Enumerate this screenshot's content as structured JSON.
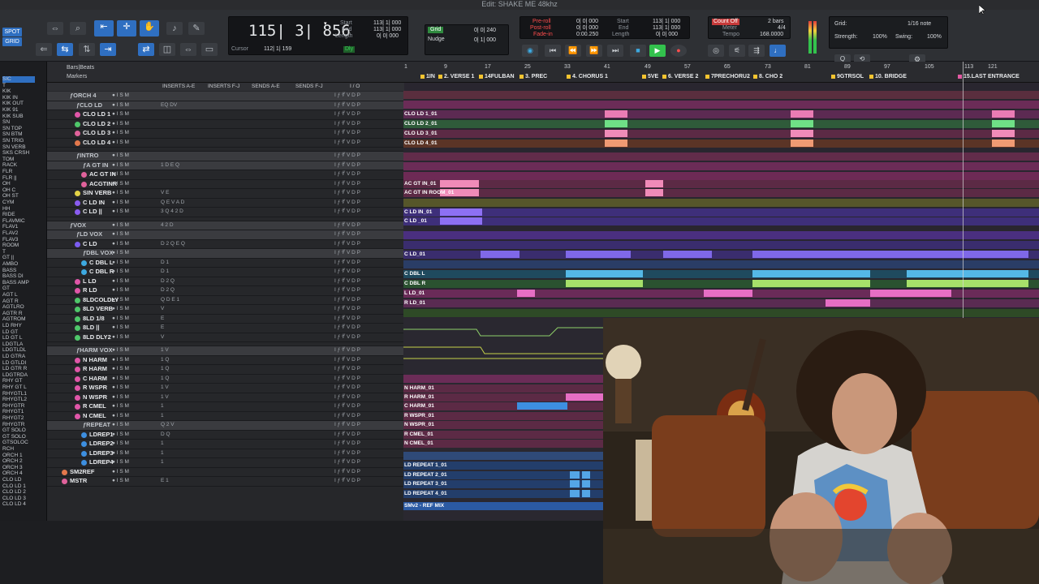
{
  "window": {
    "title": "Edit: SHAKE ME 48khz"
  },
  "toolbar": {
    "spot_label": "SPOT",
    "grid_label": "GRID",
    "counter_main": "115| 3| 856",
    "cursor_label": "Cursor",
    "cursor_value": "112| 1| 159",
    "sel_start_label": "Start",
    "sel_end_label": "End",
    "sel_length_label": "Length",
    "sel_start": "113| 1| 000",
    "sel_end": "113| 1| 000",
    "sel_length": "0| 0| 000",
    "grid_btn": "Grid",
    "nudge_btn": "Nudge",
    "grid_val": "0| 0| 240",
    "nudge_val": "0| 1| 000",
    "preroll_label": "Pre-roll",
    "postroll_label": "Post-roll",
    "fadein_label": "Fade-in",
    "preroll": "0| 0| 000",
    "postroll": "0| 0| 000",
    "fadein": "0:00.250",
    "start2_label": "Start",
    "end2_label": "End",
    "length2_label": "Length",
    "start2": "113| 1| 000",
    "end2": "113| 1| 000",
    "length2": "0| 0| 000",
    "count_off": "Count Off",
    "meter_label": "Meter",
    "tempo_label": "Tempo",
    "bars": "2 bars",
    "meter": "4/4",
    "tempo": "168.0000",
    "dly_label": "Dly",
    "grid_setting": "Grid:",
    "grid_note": "1/16 note",
    "strength_label": "Strength:",
    "strength": "100%",
    "swing_label": "Swing:",
    "swing": "100%"
  },
  "left_tracks": [
    "SIC",
    "T",
    "KIK",
    "KIK IN",
    "KIK OUT",
    "KIK 91",
    "KIK SUB",
    "SN",
    "SN TOP",
    "SN BTM",
    "SN TRIG",
    "SN VERB",
    "SKS CRSH",
    "TOM",
    "RACK",
    "FLR",
    "FLR ||",
    "OH",
    "OH C",
    "OH ST",
    "CYM",
    "HH",
    "RIDE",
    "FLAVMIC",
    "FLAV1",
    "FLAV2",
    "FLAV3",
    "ROOM",
    "T",
    "GT ||",
    "AMBO",
    "BASS",
    "BASS DI",
    "BASS AMP",
    "GT",
    "AGT L",
    "AGT R",
    "AGTLRO",
    "AGTR R",
    "AGTROM",
    "LD RHY",
    "LD GT",
    "LD GT L",
    "LDGTLA",
    "LDGTLDL",
    "LD GTRA",
    "LD GTLDI",
    "LD GTR R",
    "LDGTRDA",
    "RHY GT",
    "RHY GT L",
    "RHYGTL1",
    "RHYGTL2",
    "RHYGTR",
    "RHYGT1",
    "RHYGT2",
    "RHYGTR",
    "GT SOLO",
    "GT SOLO",
    "GTSOLOC",
    "RCH",
    "ORCH 1",
    "ORCH 2",
    "ORCH 3",
    "ORCH 4",
    "CLO LD",
    "CLO LD 1",
    "CLO LD 2",
    "CLO LD 3",
    "CLO LD 4"
  ],
  "header": {
    "bars_beats": "Bars|Beats",
    "markers": "Markers",
    "inserts_ae": "INSERTS A-E",
    "inserts_fj": "INSERTS F-J",
    "sends_ae": "SENDS A-E",
    "sends_fj": "SENDS F-J",
    "io": "I / O"
  },
  "ruler": [
    "1",
    "9",
    "17",
    "25",
    "33",
    "41",
    "49",
    "57",
    "65",
    "73",
    "81",
    "89",
    "97",
    "105",
    "113",
    "121"
  ],
  "markers": [
    "1IN",
    "2. VERSE 1",
    "14FULBAN",
    "3. PREC",
    "4. CHORUS 1",
    "5VE",
    "6. VERSE 2",
    "7PRECHORU2",
    "8. CHO 2",
    "9GTRSOL",
    "10. BRIDGE",
    "15.LAST ENTRANCE"
  ],
  "tracks": [
    {
      "name": "ORCH 4",
      "indent": 0,
      "folder": true
    },
    {
      "name": "CLO LD",
      "indent": 1,
      "folder": true,
      "ins": "EQ DV"
    },
    {
      "name": "CLO LD 1",
      "indent": 2,
      "color": "#e056a8"
    },
    {
      "name": "CLO LD 2",
      "indent": 2,
      "color": "#4fc76a"
    },
    {
      "name": "CLO LD 3",
      "indent": 2,
      "color": "#e0629b"
    },
    {
      "name": "CLO LD 4",
      "indent": 2,
      "color": "#e3784c"
    },
    {
      "name": "",
      "indent": 0,
      "spacer": true
    },
    {
      "name": "INTRO",
      "indent": 1,
      "folder": true
    },
    {
      "name": "A GT IN",
      "indent": 2,
      "folder": true,
      "ins": "1 D E Q"
    },
    {
      "name": "AC GT IN",
      "indent": 3,
      "color": "#e0629b"
    },
    {
      "name": "ACGTINR",
      "indent": 3,
      "color": "#e0629b"
    },
    {
      "name": "SIN VERB",
      "indent": 2,
      "color": "#e3d346",
      "ins": "V E"
    },
    {
      "name": "C LD IN",
      "indent": 2,
      "color": "#8a5cf0",
      "ins": "Q E V A   D"
    },
    {
      "name": "C LD ||",
      "indent": 2,
      "color": "#8a5cf0",
      "ins": "3 Q 4 2   D"
    },
    {
      "name": "",
      "indent": 0,
      "spacer": true
    },
    {
      "name": "VOX",
      "indent": 0,
      "folder": true,
      "ins": "4 2   D"
    },
    {
      "name": "LD VOX",
      "indent": 1,
      "folder": true
    },
    {
      "name": "C LD",
      "indent": 2,
      "color": "#7b5cf0",
      "ins": "D 2 Q E Q"
    },
    {
      "name": "DBL VOX",
      "indent": 2,
      "folder": true
    },
    {
      "name": "C DBL L",
      "indent": 3,
      "color": "#3da9e0",
      "ins": "D 1"
    },
    {
      "name": "C DBL R",
      "indent": 3,
      "color": "#3da9e0",
      "ins": "D 1"
    },
    {
      "name": "L LD",
      "indent": 2,
      "color": "#e056a8",
      "ins": "D 2 Q"
    },
    {
      "name": "R LD",
      "indent": 2,
      "color": "#e056a8",
      "ins": "D 2 Q"
    },
    {
      "name": "8LDCOLDLY",
      "indent": 2,
      "color": "#4fc76a",
      "ins": "Q D E 1"
    },
    {
      "name": "8LD VERB",
      "indent": 2,
      "color": "#4fc76a",
      "ins": "V"
    },
    {
      "name": "8LD 1/8",
      "indent": 2,
      "color": "#4fc76a",
      "ins": "E"
    },
    {
      "name": "8LD ||",
      "indent": 2,
      "color": "#4fc76a",
      "ins": "E"
    },
    {
      "name": "8LD DLY2",
      "indent": 2,
      "color": "#4fc76a",
      "ins": "V"
    },
    {
      "name": "",
      "indent": 0,
      "spacer": true
    },
    {
      "name": "HARM VOX",
      "indent": 1,
      "folder": true,
      "ins": "1   V"
    },
    {
      "name": "N HARM",
      "indent": 2,
      "color": "#e056a8",
      "ins": "1   Q"
    },
    {
      "name": "R HARM",
      "indent": 2,
      "color": "#e056a8",
      "ins": "1 Q"
    },
    {
      "name": "C HARM",
      "indent": 2,
      "color": "#e056a8",
      "ins": "1 Q"
    },
    {
      "name": "R WSPR",
      "indent": 2,
      "color": "#e056a8",
      "ins": "1 V"
    },
    {
      "name": "N WSPR",
      "indent": 2,
      "color": "#e056a8",
      "ins": "1 V"
    },
    {
      "name": "R CMEL",
      "indent": 2,
      "color": "#e056a8",
      "ins": "1"
    },
    {
      "name": "N CMEL",
      "indent": 2,
      "color": "#e056a8",
      "ins": "1"
    },
    {
      "name": "REPEAT",
      "indent": 2,
      "folder": true,
      "ins": "Q 2 V"
    },
    {
      "name": "LDREP1",
      "indent": 3,
      "color": "#3d8fe0",
      "ins": "D Q"
    },
    {
      "name": "LDREP2",
      "indent": 3,
      "color": "#3d8fe0",
      "ins": "1"
    },
    {
      "name": "LDREP3",
      "indent": 3,
      "color": "#3d8fe0",
      "ins": "1"
    },
    {
      "name": "LDREP4",
      "indent": 3,
      "color": "#3d8fe0",
      "ins": "1"
    },
    {
      "name": "SM2REF",
      "indent": 0,
      "color": "#e3784c"
    },
    {
      "name": "MSTR",
      "indent": 0,
      "color": "#e0629b",
      "ins": "E 1"
    }
  ],
  "clip_labels": {
    "clo1": "CLO LD 1_01",
    "clo2": "CLO LD 2_01",
    "clo3": "CLO LD 3_01",
    "clo4": "CLO LD 4_01",
    "acgt": "AC GT IN_01",
    "acgtr": "AC GT IN ROOM_01",
    "cldin": "C LD IN_01",
    "cldii": "C LD _01",
    "cld": "C LD_01",
    "cdbll": "C DBL L",
    "cdblr": "C DBL R",
    "lld": "L LD_01",
    "rld": "R LD_01",
    "nharm": "N HARM_01",
    "rharm": "R HARM_01",
    "charm": "C HARM_01",
    "rwspr": "R WSPR_01",
    "nwspr": "N WSPR_01",
    "rcmel": "R CMEL_01",
    "ncmel": "N CMEL_01",
    "rep1": "LD REPEAT 1_01",
    "rep2": "LD REPEAT 2_01",
    "rep3": "LD REPEAT 3_01",
    "rep4": "LD REPEAT 4_01",
    "ref": "SMv2 - REF MIX"
  },
  "colors": {
    "accent": "#2f6fc1",
    "play": "#33c24d",
    "marker": "#f4c430"
  }
}
